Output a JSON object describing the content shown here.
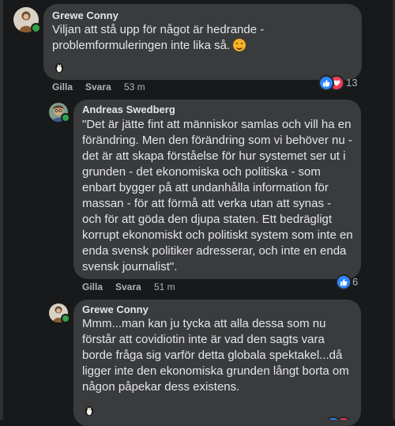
{
  "comments": [
    {
      "author": "Grewe Conny",
      "text_line1": "Viljan att stå upp för något är hedrande -",
      "text_line2": "problemformuleringen inte lika så.",
      "like_label": "Gilla",
      "reply_label": "Svara",
      "time": "53 m",
      "reaction_count": "13"
    },
    {
      "author": "Andreas Swedberg",
      "text_lines": [
        "\"Det är jätte fint att människor samlas och vill ha en",
        "förändring. Men den förändring som vi behöver nu -",
        "det är att skapa förståelse för hur systemet ser ut i",
        "grunden - det ekonomiska och politiska - som",
        "enbart bygger på att undanhålla information för",
        "massan - för att förmå att verka utan att synas -",
        "och för att göda den djupa staten. Ett bedrägligt",
        "korrupt ekonomiskt och politiskt system som inte en",
        "enda svensk politiker adresserar, och inte en enda",
        "svensk journalist\"."
      ],
      "like_label": "Gilla",
      "reply_label": "Svara",
      "time": "51 m",
      "reaction_count": "6"
    },
    {
      "author": "Grewe Conny",
      "text_lines": [
        "Mmm...man kan ju tycka att alla dessa som nu",
        "förstår att covidiotin inte är vad den sagts vara",
        "borde fråga sig varför detta globala spektakel...då",
        "ligger inte den ekonomiska grunden långt borta om",
        "någon påpekar dess existens."
      ]
    }
  ],
  "colors": {
    "background": "#18191a",
    "bubble": "#3a3b3c",
    "text": "#e4e6eb",
    "secondary_text": "#b0b3b8",
    "like_blue": "#2d88ff",
    "love_red": "#f33e58",
    "online_green": "#31a24c"
  },
  "icons": [
    "avatar",
    "online-dot",
    "smile-emoji",
    "tux-icon",
    "like-reaction-icon",
    "love-reaction-icon"
  ]
}
